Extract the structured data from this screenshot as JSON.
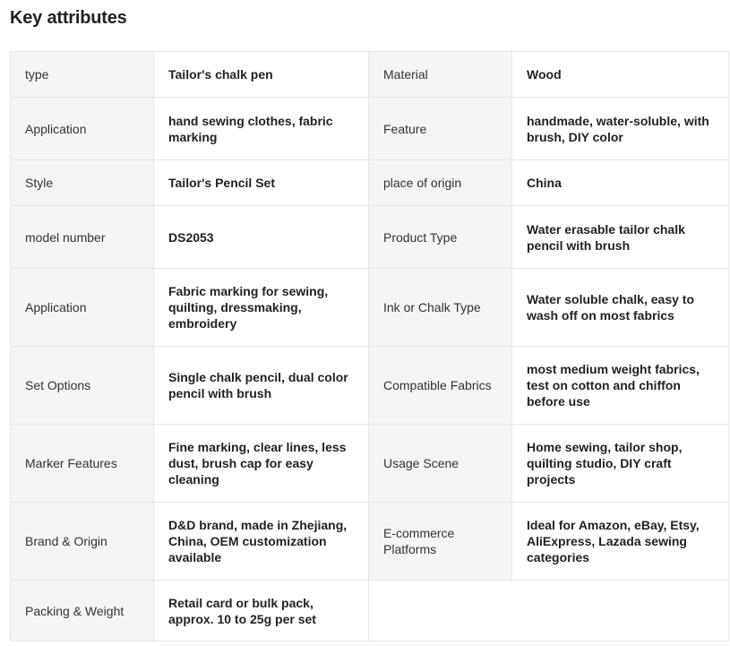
{
  "title": "Key attributes",
  "rows": [
    [
      {
        "key": "type",
        "value": "Tailor's chalk pen"
      },
      {
        "key": "Material",
        "value": "Wood"
      }
    ],
    [
      {
        "key": "Application",
        "value": "hand sewing clothes, fabric marking"
      },
      {
        "key": "Feature",
        "value": "handmade, water-soluble, with brush, DIY color"
      }
    ],
    [
      {
        "key": "Style",
        "value": "Tailor's Pencil Set"
      },
      {
        "key": "place of origin",
        "value": "China"
      }
    ],
    [
      {
        "key": "model number",
        "value": "DS2053"
      },
      {
        "key": "Product Type",
        "value": "Water erasable tailor chalk pencil with brush"
      }
    ],
    [
      {
        "key": "Application",
        "value": "Fabric marking for sewing, quilting, dressmaking, embroidery"
      },
      {
        "key": "Ink or Chalk Type",
        "value": "Water soluble chalk, easy to wash off on most fabrics"
      }
    ],
    [
      {
        "key": "Set Options",
        "value": "Single chalk pencil, dual color pencil with brush"
      },
      {
        "key": "Compatible Fabrics",
        "value": "most medium weight fabrics, test on cotton and chiffon before use"
      }
    ],
    [
      {
        "key": "Marker Features",
        "value": "Fine marking, clear lines, less dust, brush cap for easy cleaning"
      },
      {
        "key": "Usage Scene",
        "value": "Home sewing, tailor shop, quilting studio, DIY craft projects"
      }
    ],
    [
      {
        "key": "Brand & Origin",
        "value": "D&D brand, made in Zhejiang, China, OEM customization available"
      },
      {
        "key": "E-commerce Platforms",
        "value": "Ideal for Amazon, eBay, Etsy, AliExpress, Lazada sewing categories"
      }
    ],
    [
      {
        "key": "Packing & Weight",
        "value": "Retail card or bulk pack, approx. 10 to 25g per set"
      }
    ]
  ],
  "colors": {
    "key_bg": "#f5f5f5",
    "value_bg": "#ffffff",
    "border": "#e6e6e6",
    "text": "#222222"
  }
}
